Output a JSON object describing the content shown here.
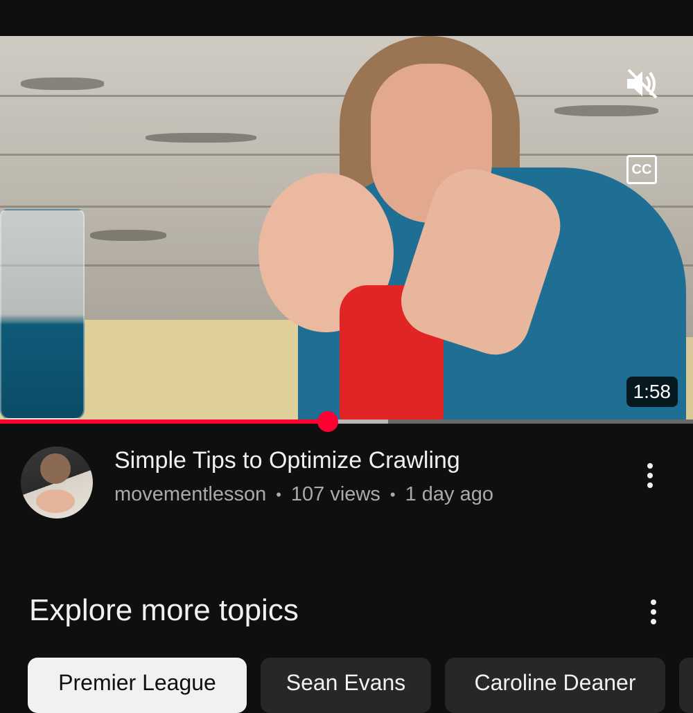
{
  "video": {
    "duration": "1:58",
    "progress": 0.473,
    "buffered": 0.56,
    "mute_icon": "volume-off-icon",
    "cc_label": "CC"
  },
  "video_info": {
    "title": "Simple Tips to Optimize Crawling",
    "channel": "movementlesson",
    "views": "107 views",
    "age": "1 day ago",
    "separator": "•"
  },
  "explore": {
    "title": "Explore more topics",
    "chips": [
      {
        "label": "Premier League",
        "selected": true
      },
      {
        "label": "Sean Evans",
        "selected": false
      },
      {
        "label": "Caroline Deaner",
        "selected": false
      }
    ]
  },
  "colors": {
    "accent": "#ff0033",
    "background": "#0f0f0f",
    "secondary_text": "#aaaaaa"
  }
}
